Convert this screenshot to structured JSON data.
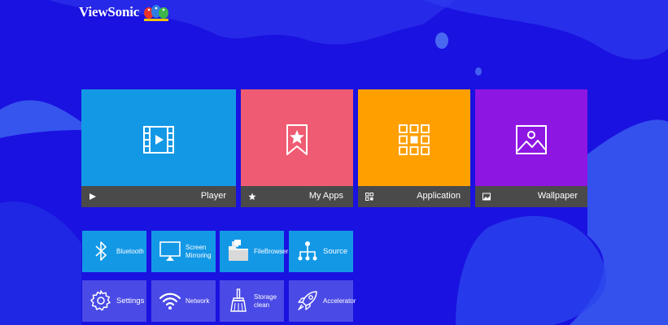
{
  "brand": {
    "name": "ViewSonic",
    "logo_icon": "birds-logo-icon"
  },
  "colors": {
    "background": "#1a12e0",
    "player": "#1398e6",
    "my_apps": "#ef5b72",
    "application": "#ff9f00",
    "wallpaper": "#8e16e3",
    "quick_row1": "#1398e6",
    "quick_row2": "#4a4ae6",
    "tile_bar": "#4a4a4a"
  },
  "main_tiles": [
    {
      "label": "Player",
      "icon": "film-play-icon",
      "bar_icon": "play-icon"
    },
    {
      "label": "My Apps",
      "icon": "bookmark-star-icon",
      "bar_icon": "star-icon"
    },
    {
      "label": "Application",
      "icon": "app-grid-icon",
      "bar_icon": "grid-icon"
    },
    {
      "label": "Wallpaper",
      "icon": "picture-icon",
      "bar_icon": "picture-icon"
    }
  ],
  "quick_row1": [
    {
      "label": "Bluetooth",
      "icon": "bluetooth-icon"
    },
    {
      "label": "Screen Mirroring",
      "icon": "screen-mirroring-icon"
    },
    {
      "label": "FileBrowser",
      "icon": "folder-icon"
    },
    {
      "label": "Source",
      "icon": "source-icon"
    }
  ],
  "quick_row2": [
    {
      "label": "Settings",
      "icon": "gear-icon"
    },
    {
      "label": "Network",
      "icon": "wifi-icon"
    },
    {
      "label": "Storage clean",
      "icon": "broom-icon"
    },
    {
      "label": "Accelerator",
      "icon": "rocket-icon"
    }
  ]
}
